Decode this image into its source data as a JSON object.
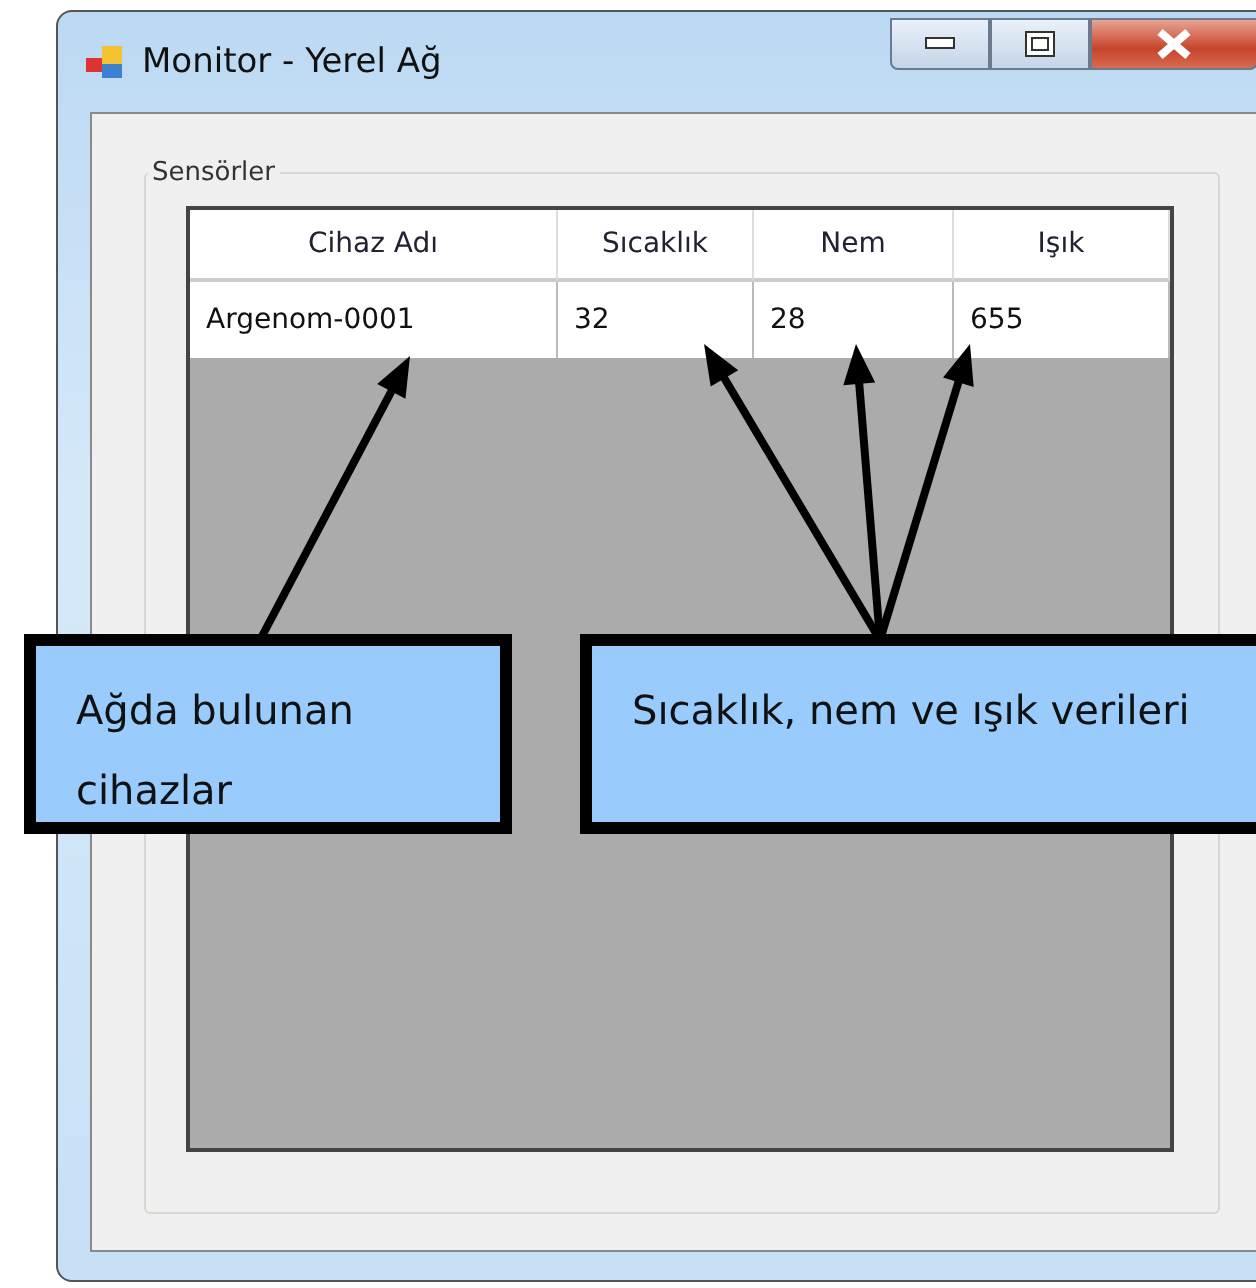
{
  "window": {
    "title": "Monitor - Yerel Ağ"
  },
  "group": {
    "label": "Sensörler"
  },
  "table": {
    "columns": [
      "Cihaz Adı",
      "Sıcaklık",
      "Nem",
      "Işık"
    ],
    "rows": [
      [
        "Argenom-0001",
        "32",
        "28",
        "655"
      ]
    ]
  },
  "callouts": [
    {
      "text": "Ağda bulunan cihazlar"
    },
    {
      "text": "Sıcaklık, nem ve ışık verileri"
    }
  ]
}
